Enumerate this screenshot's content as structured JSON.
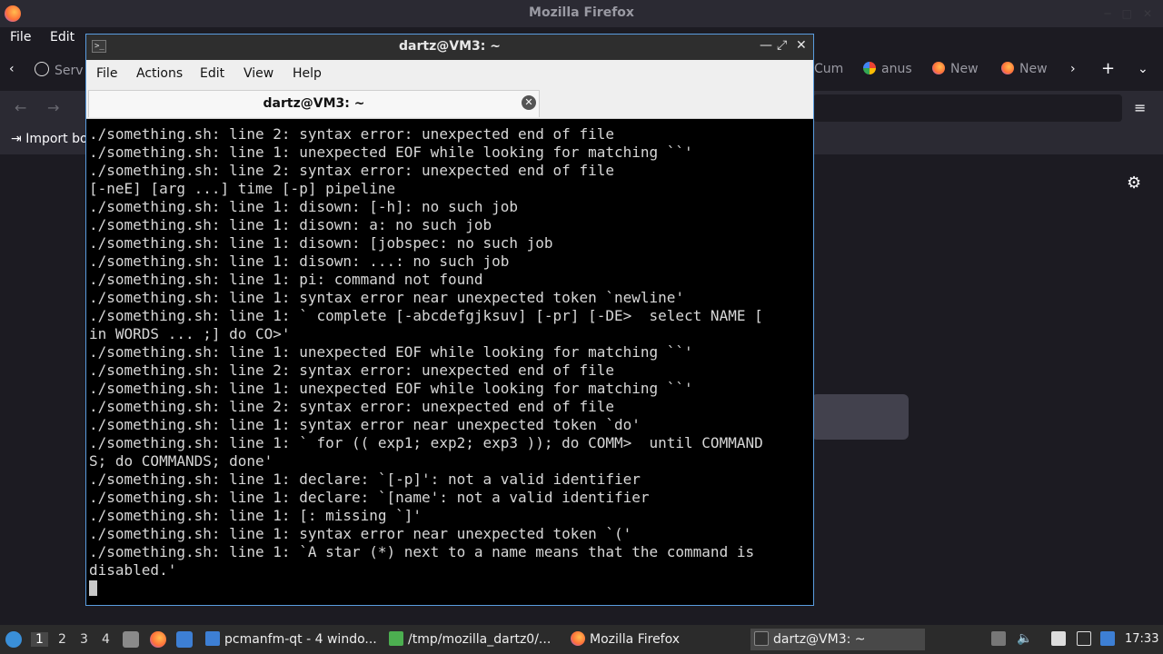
{
  "firefox": {
    "title": "Mozilla Firefox",
    "menu": [
      "File",
      "Edit"
    ],
    "tabs": [
      "Serv",
      "Cum",
      "anus",
      "New",
      "New"
    ],
    "bookmark": "Import bo"
  },
  "terminal": {
    "title": "dartz@VM3: ~",
    "menu": [
      "File",
      "Actions",
      "Edit",
      "View",
      "Help"
    ],
    "tab_label": "dartz@VM3: ~",
    "lines": [
      "./something.sh: line 2: syntax error: unexpected end of file",
      "./something.sh: line 1: unexpected EOF while looking for matching ``'",
      "./something.sh: line 2: syntax error: unexpected end of file",
      "[-neE] [arg ...] time [-p] pipeline",
      "./something.sh: line 1: disown: [-h]: no such job",
      "./something.sh: line 1: disown: a: no such job",
      "./something.sh: line 1: disown: [jobspec: no such job",
      "./something.sh: line 1: disown: ...: no such job",
      "./something.sh: line 1: pi: command not found",
      "./something.sh: line 1: syntax error near unexpected token `newline'",
      "./something.sh: line 1: ` complete [-abcdefgjksuv] [-pr] [-DE>  select NAME [",
      "in WORDS ... ;] do CO>'",
      "./something.sh: line 1: unexpected EOF while looking for matching ``'",
      "./something.sh: line 2: syntax error: unexpected end of file",
      "./something.sh: line 1: unexpected EOF while looking for matching ``'",
      "./something.sh: line 2: syntax error: unexpected end of file",
      "./something.sh: line 1: syntax error near unexpected token `do'",
      "./something.sh: line 1: ` for (( exp1; exp2; exp3 )); do COMM>  until COMMAND",
      "S; do COMMANDS; done'",
      "./something.sh: line 1: declare: `[-p]': not a valid identifier",
      "./something.sh: line 1: declare: `[name': not a valid identifier",
      "./something.sh: line 1: [: missing `]'",
      "./something.sh: line 1: syntax error near unexpected token `('",
      "./something.sh: line 1: `A star (*) next to a name means that the command is",
      "disabled.'"
    ]
  },
  "taskbar": {
    "workspaces": [
      "1",
      "2",
      "3",
      "4"
    ],
    "tasks": [
      "pcmanfm-qt - 4 windo...",
      "/tmp/mozilla_dartz0/...",
      "Mozilla Firefox",
      "dartz@VM3: ~"
    ],
    "clock": "17:33"
  }
}
